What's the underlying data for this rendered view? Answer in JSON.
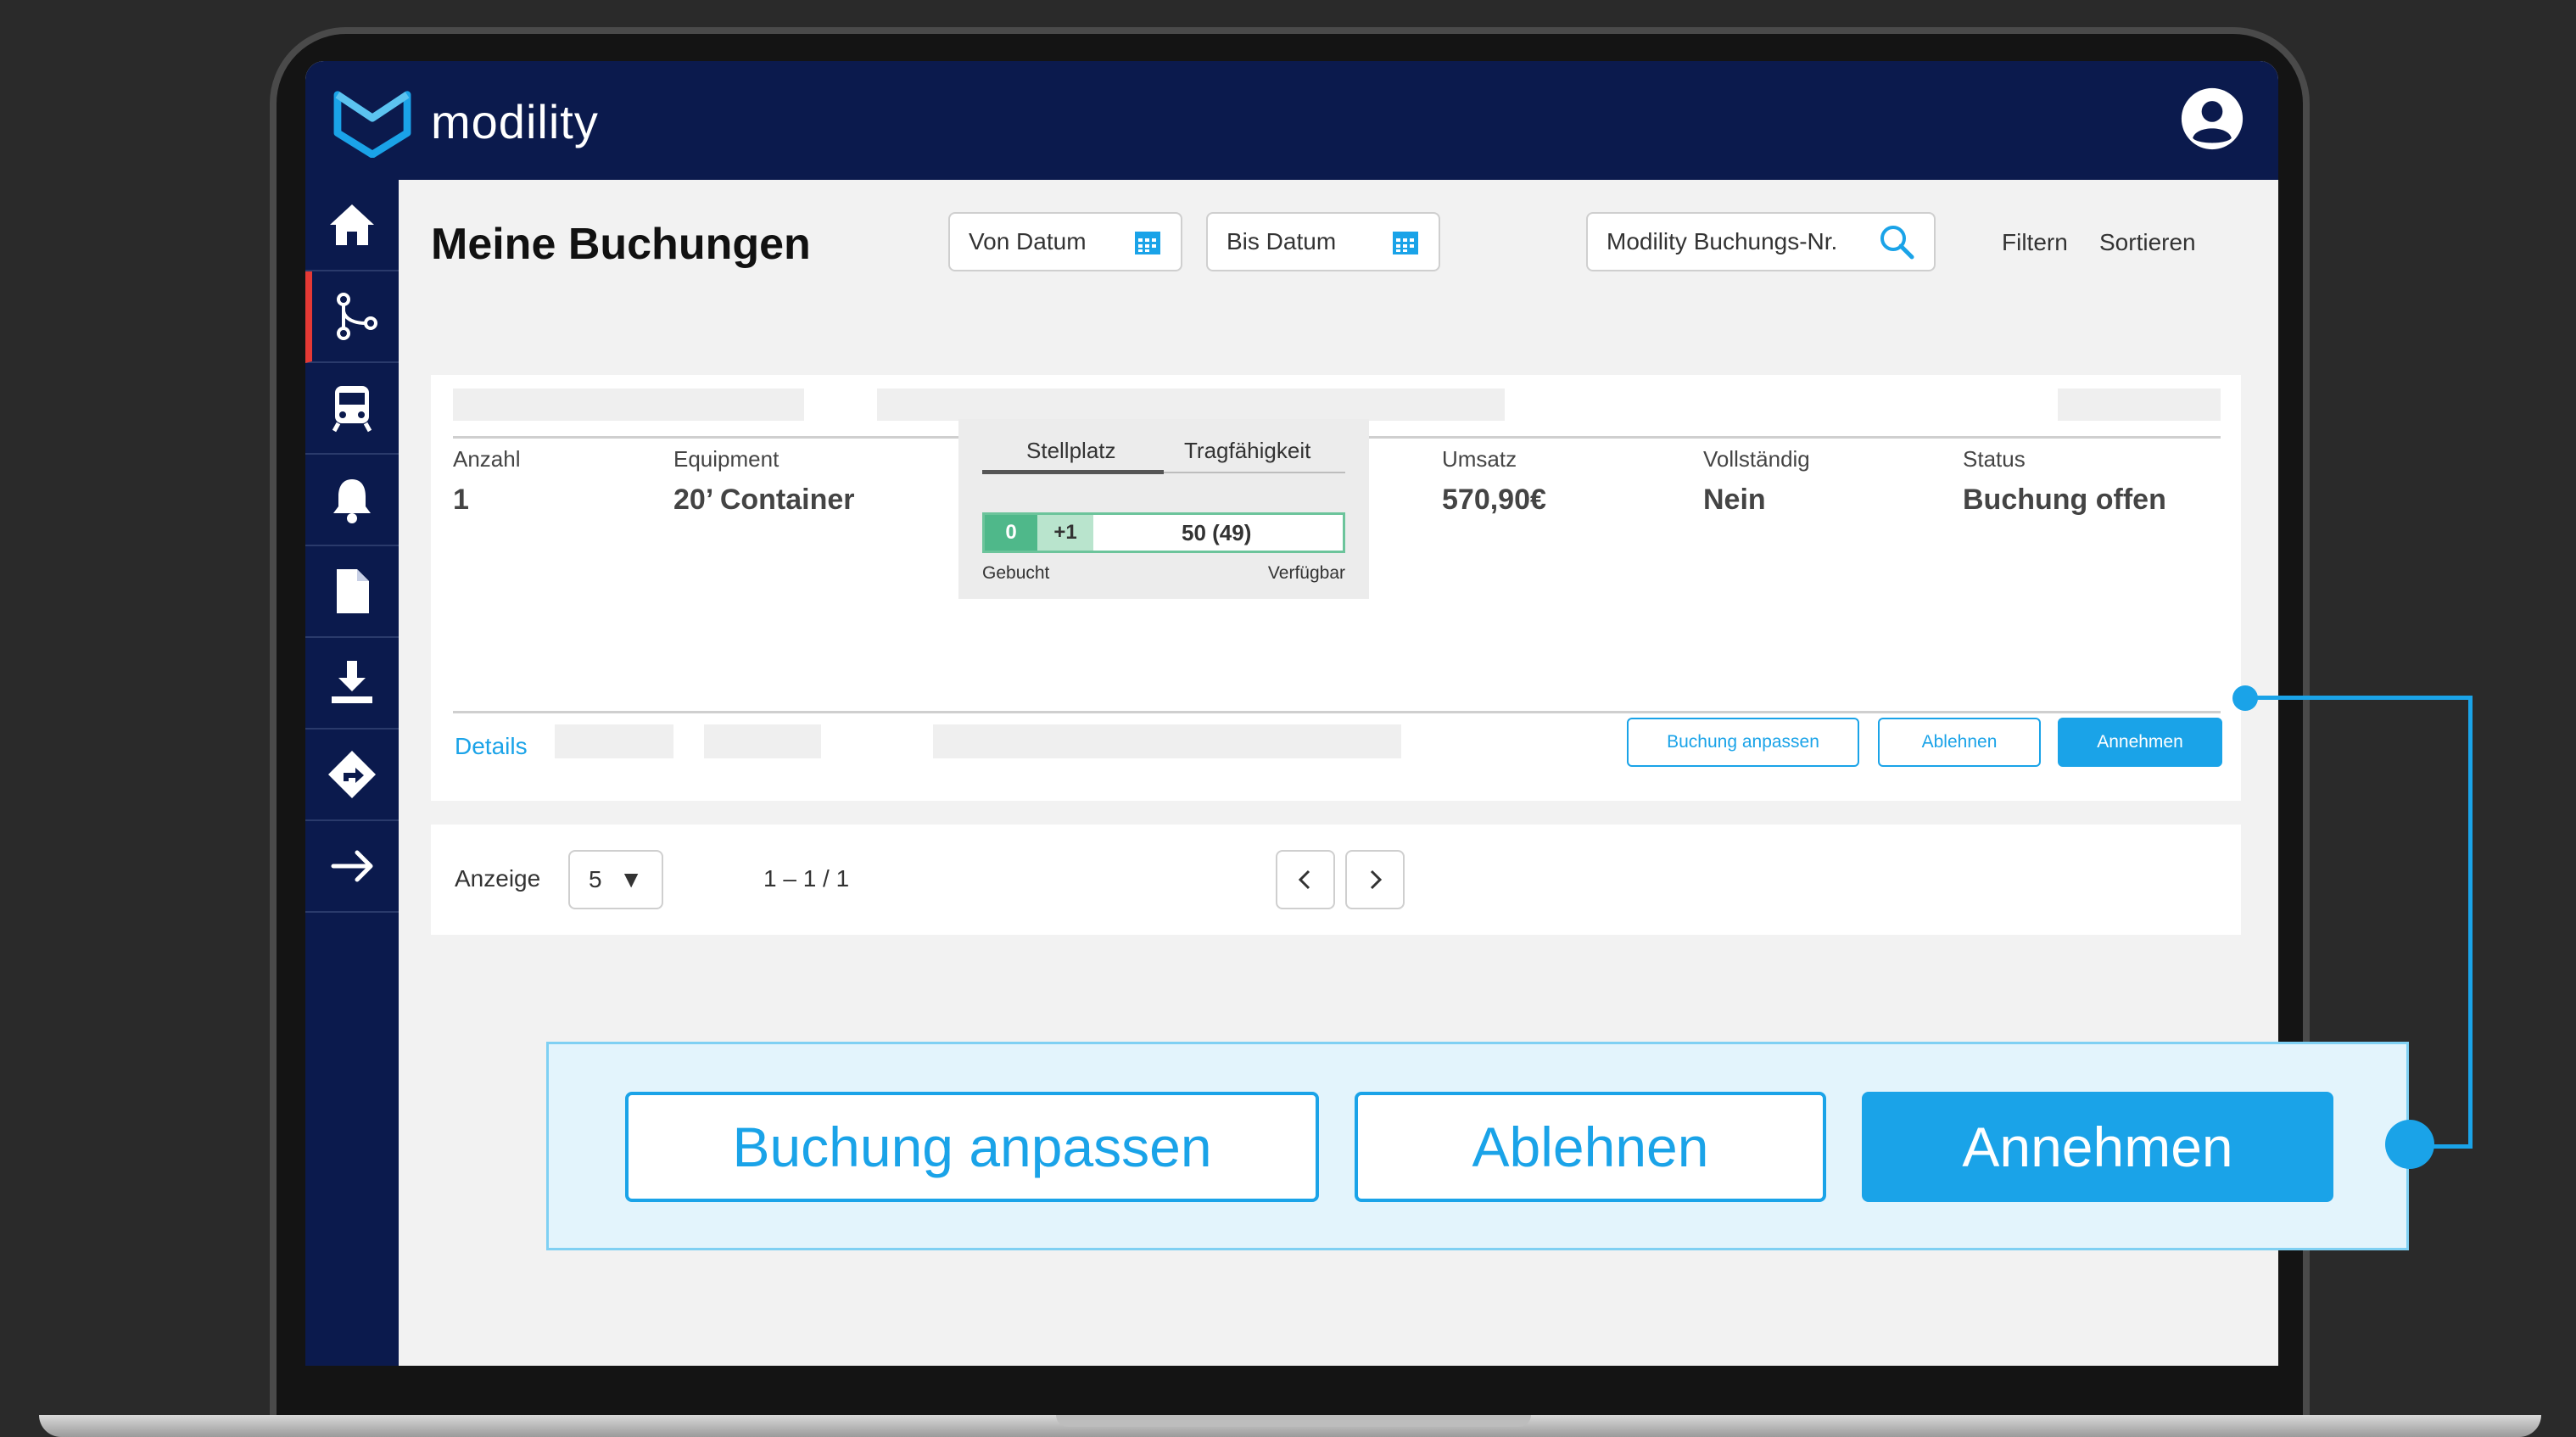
{
  "app": {
    "name": "modility"
  },
  "colors": {
    "brand_navy": "#0b1a4d",
    "accent": "#1aa3e8",
    "active_marker": "#e53935",
    "booked": "#4fb88a"
  },
  "sidebar": {
    "items": [
      {
        "icon": "home-icon",
        "active": false
      },
      {
        "icon": "route-icon",
        "active": true
      },
      {
        "icon": "train-icon",
        "active": false
      },
      {
        "icon": "bell-icon",
        "active": false
      },
      {
        "icon": "document-icon",
        "active": false
      },
      {
        "icon": "download-icon",
        "active": false
      },
      {
        "icon": "direction-icon",
        "active": false
      },
      {
        "icon": "arrow-right-icon",
        "active": false
      }
    ]
  },
  "header": {
    "title": "Meine Buchungen",
    "from_date_placeholder": "Von Datum",
    "to_date_placeholder": "Bis Datum",
    "search_placeholder": "Modility Buchungs-Nr.",
    "filter_label": "Filtern",
    "sort_label": "Sortieren"
  },
  "booking": {
    "quantity_label": "Anzahl",
    "quantity_value": "1",
    "equipment_label": "Equipment",
    "equipment_value": "20’ Container",
    "capacity": {
      "tab_1": "Stellplatz",
      "tab_2": "Tragfähigkeit",
      "booked": "0",
      "added": "+1",
      "available": "50 (49)",
      "booked_label": "Gebucht",
      "available_label": "Verfügbar"
    },
    "revenue_label": "Umsatz",
    "revenue_value": "570,90€",
    "complete_label": "Vollständig",
    "complete_value": "Nein",
    "status_label": "Status",
    "status_value": "Buchung offen",
    "details_link": "Details",
    "actions": {
      "adjust": "Buchung anpassen",
      "decline": "Ablehnen",
      "accept": "Annehmen"
    }
  },
  "pagination": {
    "label": "Anzeige",
    "page_size": "5",
    "range": "1 – 1 / 1"
  },
  "callout": {
    "adjust": "Buchung anpassen",
    "decline": "Ablehnen",
    "accept": "Annehmen"
  }
}
